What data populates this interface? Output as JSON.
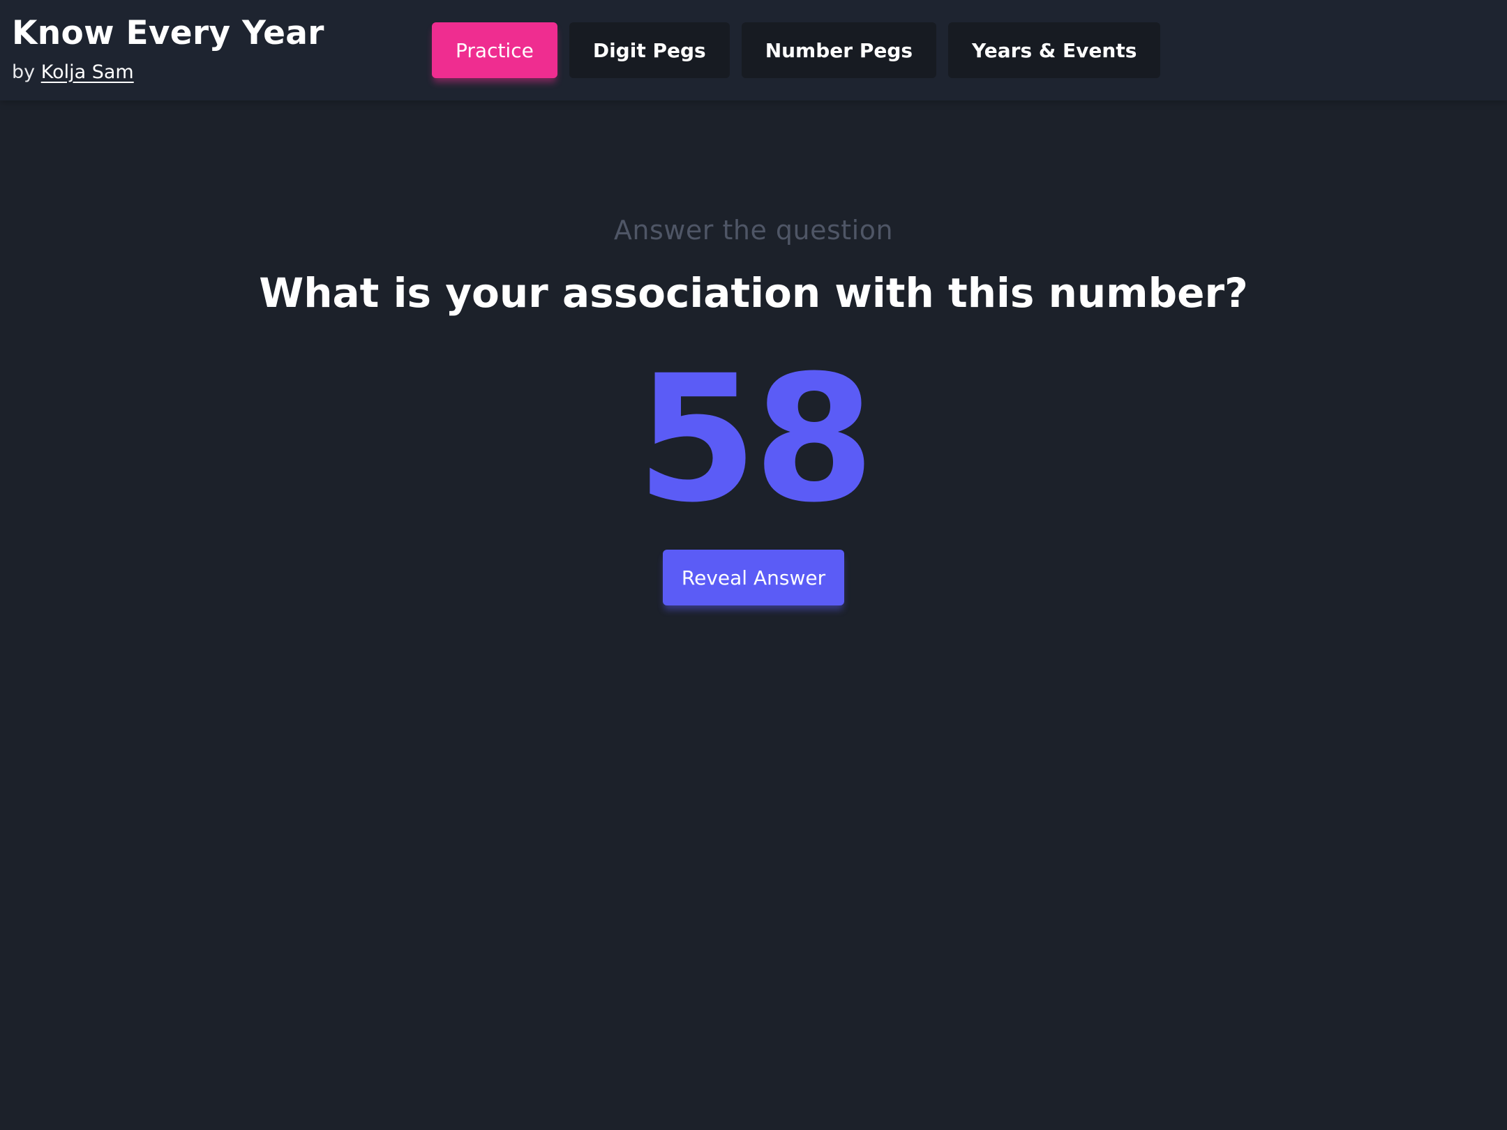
{
  "header": {
    "title": "Know Every Year",
    "byline_prefix": "by",
    "author": "Kolja Sam"
  },
  "nav": {
    "tabs": [
      {
        "label": "Practice",
        "active": true
      },
      {
        "label": "Digit Pegs",
        "active": false
      },
      {
        "label": "Number Pegs",
        "active": false
      },
      {
        "label": "Years & Events",
        "active": false
      }
    ]
  },
  "quiz": {
    "prompt": "Answer the question",
    "question": "What is your association with this number?",
    "number": "58",
    "reveal_label": "Reveal Answer"
  },
  "colors": {
    "background": "#1c212a",
    "header": "#1e2430",
    "active_tab": "#ef2d90",
    "accent": "#5b5cf6",
    "inactive_tab": "#171b22"
  }
}
